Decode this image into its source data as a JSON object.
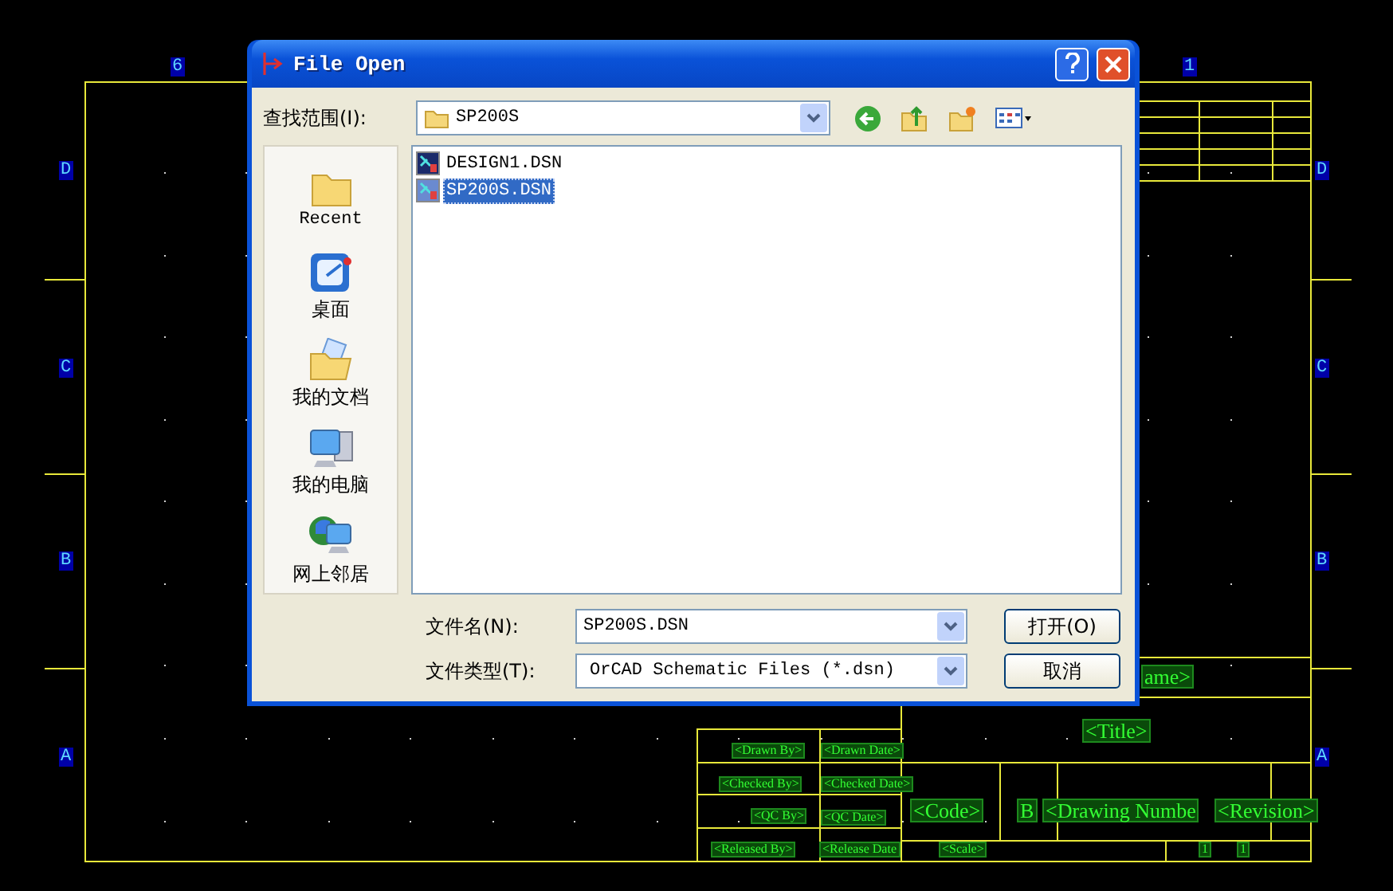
{
  "schematic": {
    "column_labels": [
      "6",
      "1"
    ],
    "row_labels_left": [
      "D",
      "C",
      "B",
      "A"
    ],
    "row_labels_right": [
      "D",
      "C",
      "B",
      "A"
    ],
    "title_block": [
      {
        "text": "ame>",
        "kind": "large"
      },
      {
        "text": "<Title>",
        "kind": "large"
      },
      {
        "text": "<Drawn By>",
        "kind": "small"
      },
      {
        "text": "<Drawn Date>",
        "kind": "small"
      },
      {
        "text": "<Checked By>",
        "kind": "small"
      },
      {
        "text": "<Checked Date>",
        "kind": "small"
      },
      {
        "text": "<QC By>",
        "kind": "small"
      },
      {
        "text": "<QC Date>",
        "kind": "small"
      },
      {
        "text": "<Released By>",
        "kind": "small"
      },
      {
        "text": "<Release Date",
        "kind": "small"
      },
      {
        "text": "<Scale>",
        "kind": "small"
      },
      {
        "text": "<Code>",
        "kind": "large"
      },
      {
        "text": "B",
        "kind": "large"
      },
      {
        "text": "<Drawing Numbe",
        "kind": "large"
      },
      {
        "text": "<Revision>",
        "kind": "large"
      },
      {
        "text": "1",
        "kind": "small"
      },
      {
        "text": "1",
        "kind": "small"
      }
    ]
  },
  "dialog": {
    "title": "File Open",
    "look_in_label": "查找范围(I):",
    "look_in_value": "SP200S",
    "places": [
      {
        "kind": "recent",
        "label": "Recent"
      },
      {
        "kind": "desktop",
        "label": "桌面"
      },
      {
        "kind": "documents",
        "label": "我的文档"
      },
      {
        "kind": "computer",
        "label": "我的电脑"
      },
      {
        "kind": "network",
        "label": "网上邻居"
      }
    ],
    "files": [
      {
        "name": "DESIGN1.DSN",
        "selected": false
      },
      {
        "name": "SP200S.DSN",
        "selected": true
      }
    ],
    "file_name_label": "文件名(N):",
    "file_name_value": "SP200S.DSN",
    "file_type_label": "文件类型(T):",
    "file_type_value": "OrCAD Schematic Files (*.dsn)",
    "buttons": [
      "打开(O)",
      "取消"
    ]
  }
}
